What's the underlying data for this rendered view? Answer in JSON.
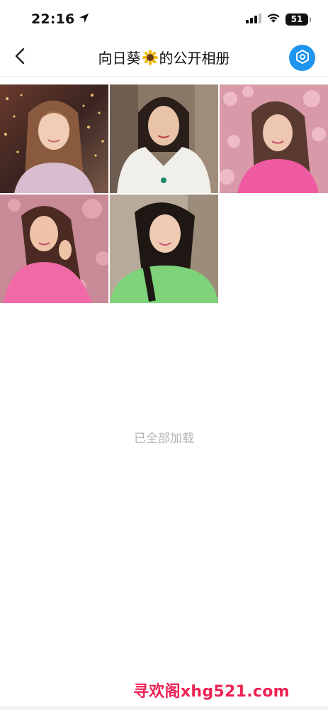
{
  "status_bar": {
    "time": "22:16",
    "battery": "51",
    "icons": [
      "location-arrow-icon",
      "signal-icon",
      "wifi-icon",
      "battery-icon"
    ]
  },
  "nav": {
    "title_prefix": "向日葵",
    "title_emoji": "sunflower-emoji",
    "title_suffix": "的公开相册",
    "back_icon": "chevron-left-icon",
    "more_icon": "hexagon-settings-icon",
    "accent_color": "#1e96f0"
  },
  "photos": [
    {
      "name": "photo-1",
      "desc": "woman-in-lights-lavender-sweater"
    },
    {
      "name": "photo-2",
      "desc": "woman-white-puffer-jacket"
    },
    {
      "name": "photo-3",
      "desc": "woman-pink-top-cherry-blossoms"
    },
    {
      "name": "photo-4",
      "desc": "woman-pink-sweater-blossoms"
    },
    {
      "name": "photo-5",
      "desc": "woman-green-sweater-braid"
    }
  ],
  "footer": {
    "loaded_text": "已全部加载"
  },
  "watermark": {
    "text": "寻欢阁xhg521.com",
    "color": "#ee2255"
  }
}
